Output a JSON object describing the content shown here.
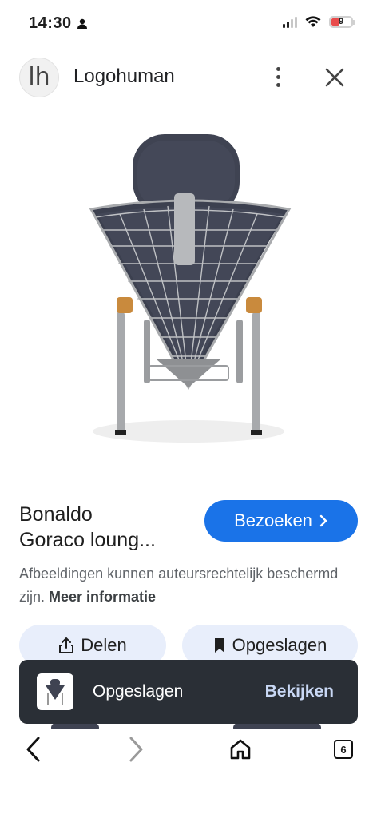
{
  "status_bar": {
    "time": "14:30",
    "battery": "9"
  },
  "header": {
    "site_name": "Logohuman",
    "logo_glyph": "lh"
  },
  "product": {
    "title_line1": "Bonaldo",
    "title_line2": "Goraco loung...",
    "visit_label": "Bezoeken",
    "copyright_text": "Afbeeldingen kunnen auteursrechtelijk beschermd zijn.",
    "more_info_label": "Meer informatie"
  },
  "actions": {
    "share_label": "Delen",
    "save_label": "Opgeslagen"
  },
  "snackbar": {
    "message": "Opgeslagen",
    "action_label": "Bekijken"
  },
  "nav": {
    "tabs_count": "6"
  },
  "colors": {
    "accent": "#1a73e8",
    "pill_bg": "#e8eefb",
    "snackbar_bg": "#2a2f36",
    "battery_low": "#e94b4b"
  }
}
